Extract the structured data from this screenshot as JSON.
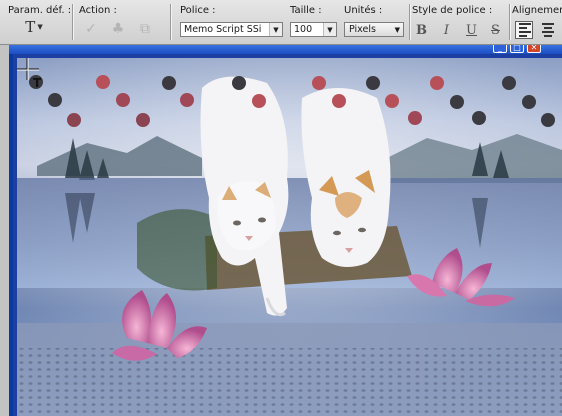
{
  "options_bar": {
    "preset": {
      "label": "Param. déf. :",
      "tool_glyph": "T",
      "icon": "type-tool-icon"
    },
    "action": {
      "label": "Action :",
      "icons": [
        "check-icon",
        "toggle-warp-icon",
        "warp-text-icon"
      ]
    },
    "font": {
      "label": "Police :",
      "value": "Memo Script SSi"
    },
    "size": {
      "label": "Taille :",
      "value": "100"
    },
    "units": {
      "label": "Unités :",
      "value": "Pixels"
    },
    "font_style": {
      "label": "Style de police :",
      "bold": "B",
      "italic": "I",
      "underline": "U",
      "strike": "S"
    },
    "alignment": {
      "label": "Alignement",
      "active": "left-align"
    }
  },
  "document": {
    "close_glyph": "✕",
    "minimize_glyph": "_",
    "maximize_glyph": "□"
  },
  "canvas": {
    "cursor_glyph": "T",
    "colors": {
      "sky": "#b8c4de",
      "water": "#6f86b3",
      "cat_fur": "#f4f3f6",
      "cat_patch": "#d49a55",
      "lotus": "#e083b8",
      "dot_dark": "#3a3a40",
      "dot_red": "#b8505a"
    }
  }
}
